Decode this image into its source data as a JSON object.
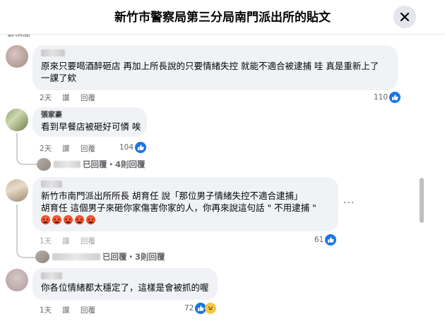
{
  "header": {
    "title": "新竹市警察局第三分局南門派出所的貼文",
    "close_icon": "close-icon"
  },
  "top_cut_text": "最相關",
  "comments": [
    {
      "author": "",
      "lines": [
        "原來只要喝酒醉砸店 再加上所長說的只要情緒失控 就能不適合被逮捕 哇 真是重新上了",
        "一課了欸"
      ],
      "time": "2天",
      "like": "讚",
      "reply": "回覆",
      "reactions": "110"
    },
    {
      "author": "張家豪",
      "lines": [
        "看到早餐店被砸好可憐 唉"
      ],
      "time": "2天",
      "like": "讚",
      "reply": "回覆",
      "reactions": "104",
      "replies_label": "已回覆・4則回覆"
    },
    {
      "author": "",
      "lines": [
        "新竹市南門派出所所長 胡育任 說「那位男子情緒失控不適合逮捕」",
        "胡育任 這個男子來砸你家傷害你家的人，你再來說這句話 \" 不用逮捕     \""
      ],
      "time": "1天",
      "like": "讚",
      "reply": "回覆",
      "reactions": "61",
      "replies_label": "已回覆・3則回覆",
      "more": "···"
    },
    {
      "author": "",
      "lines": [
        "你各位情緒都太穩定了，這樣是會被抓的喔"
      ],
      "time": "1天",
      "like": "讚",
      "reply": "回覆",
      "reactions": "72"
    }
  ],
  "colors": {
    "bubble": "#f0f2f5",
    "like_blue": "#1b74e4",
    "meta_gray": "#65676b"
  }
}
